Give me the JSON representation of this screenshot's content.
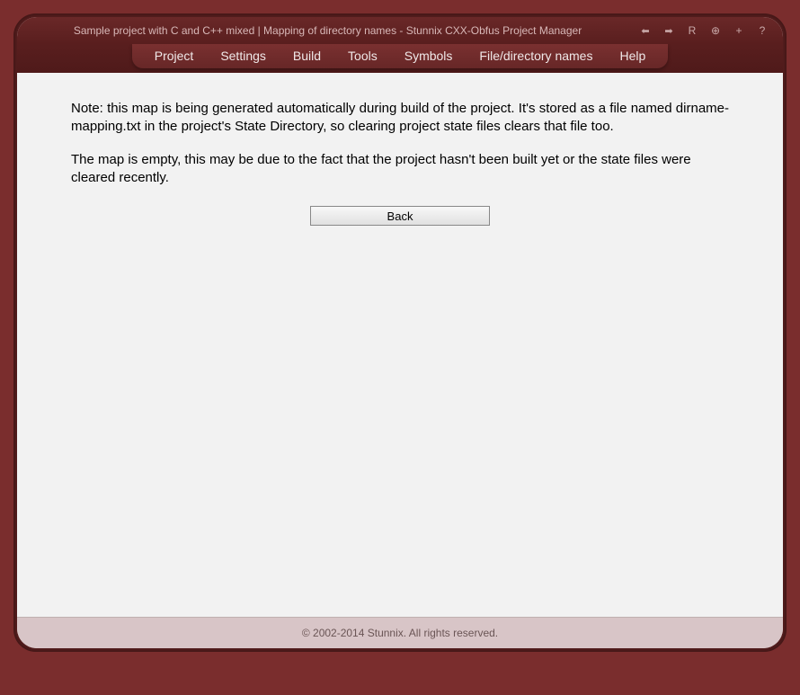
{
  "titlebar": {
    "title": "Sample project with C and C++ mixed | Mapping of directory names - Stunnix CXX-Obfus Project Manager",
    "icons": {
      "back": "⬅",
      "forward": "➡",
      "reload": "R",
      "zoom_in": "⊕",
      "add": "+",
      "help": "?"
    }
  },
  "menu": {
    "project": "Project",
    "settings": "Settings",
    "build": "Build",
    "tools": "Tools",
    "symbols": "Symbols",
    "filedir": "File/directory names",
    "help": "Help"
  },
  "content": {
    "note1": "Note: this map is being generated automatically during build of the project. It's stored as a file named dirname-mapping.txt in the project's State Directory, so clearing project state files clears that file too.",
    "note2": "The map is empty, this may be due to the fact that the project hasn't been built yet or the state files were cleared recently.",
    "back_button": "Back"
  },
  "footer": {
    "copyright": "© 2002-2014 Stunnix. All rights reserved."
  }
}
